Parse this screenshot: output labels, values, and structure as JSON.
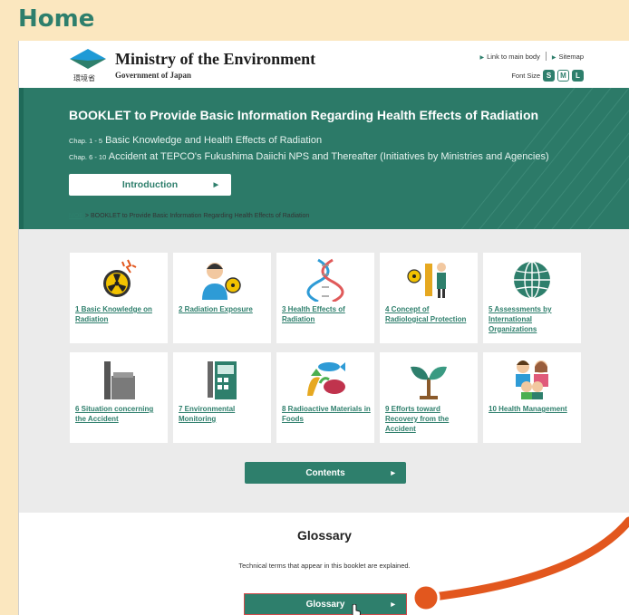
{
  "page": {
    "title": "Home"
  },
  "header": {
    "ministry": "Ministry of the Environment",
    "government": "Government of Japan",
    "logo_sub": "環境省",
    "link_main": "Link to main body",
    "link_sitemap": "Sitemap",
    "font_size_label": "Font Size",
    "font_sizes": [
      "S",
      "M",
      "L"
    ]
  },
  "banner": {
    "title": "BOOKLET to Provide Basic Information Regarding Health Effects of Radiation",
    "chap1_prefix": "Chap. 1 - 5",
    "chap1_text": "Basic Knowledge and Health Effects of Radiation",
    "chap2_prefix": "Chap. 6 - 10",
    "chap2_text": "Accident at TEPCO's Fukushima Daiichi NPS and Thereafter (Initiatives by Ministries and Agencies)",
    "intro_label": "Introduction"
  },
  "breadcrumb": {
    "root": "MOE",
    "separator": ">",
    "current": "BOOKLET to Provide Basic Information Regarding Health Effects of Radiation"
  },
  "chapters": [
    {
      "label": "1 Basic Knowledge on Radiation",
      "icon": "radiation-icon"
    },
    {
      "label": "2 Radiation Exposure",
      "icon": "person-exposure-icon"
    },
    {
      "label": "3 Health Effects of Radiation",
      "icon": "dna-icon"
    },
    {
      "label": "4 Concept of Radiological Protection",
      "icon": "protection-icon"
    },
    {
      "label": "5 Assessments by International Organizations",
      "icon": "globe-icon"
    },
    {
      "label": "6 Situation concerning the Accident",
      "icon": "power-plant-icon"
    },
    {
      "label": "7 Environmental Monitoring",
      "icon": "monitoring-post-icon"
    },
    {
      "label": "8 Radioactive Materials in Foods",
      "icon": "food-icon"
    },
    {
      "label": "9 Efforts toward Recovery from the Accident",
      "icon": "sprout-icon"
    },
    {
      "label": "10 Health Management",
      "icon": "family-icon"
    }
  ],
  "contents_label": "Contents",
  "glossary": {
    "title": "Glossary",
    "description": "Technical terms that appear in this booklet are explained.",
    "button_label": "Glossary"
  },
  "colors": {
    "accent": "#2e7f6c",
    "page_bg": "#fbe7bf",
    "callout": "#e2571e"
  }
}
